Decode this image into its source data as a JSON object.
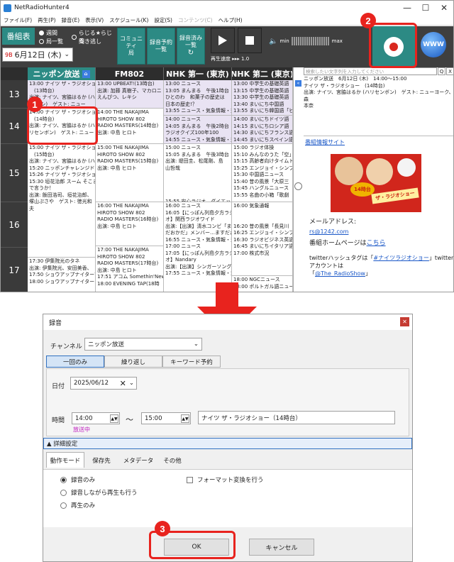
{
  "app": {
    "title": "NetRadioHunter4",
    "menu": [
      {
        "label": "ファイル(F)",
        "disabled": false
      },
      {
        "label": "再生(P)",
        "disabled": false
      },
      {
        "label": "録音(E)",
        "disabled": false
      },
      {
        "label": "表示(V)",
        "disabled": false
      },
      {
        "label": "スケジュール(K)",
        "disabled": false
      },
      {
        "label": "設定(S)",
        "disabled": false
      },
      {
        "label": "コンテンツ(C)",
        "disabled": true
      },
      {
        "label": "ヘルプ(H)",
        "disabled": false
      }
    ]
  },
  "toolbar": {
    "program_table": "番組表",
    "radio_weekly": "週間",
    "radio_station_list": "局一覧",
    "radio_rajiru": "らじる★らじる",
    "radio_rajiru2": "聞き逃し",
    "community_btn": [
      "コミュニティ",
      "局"
    ],
    "reserve_btn": [
      "録音予約",
      "一覧"
    ],
    "recorded_btn": [
      "録音済み",
      "一覧"
    ],
    "speed_label": "再生速度",
    "speed_value": "1.0",
    "vol_min": "min",
    "vol_max": "max",
    "date": "6月12日 (木)",
    "date_icon": "9B",
    "www": "WWW"
  },
  "grid": {
    "channels": [
      "ニッポン放送",
      "FM802",
      "NHK 第一 (東京)",
      "NHK 第二 (東京)"
    ],
    "hours": [
      "13",
      "14",
      "15",
      "16",
      "17"
    ],
    "programs": [
      {
        "text": "13:00 ナイツ ザ・ラジオショー\n　(13時台)\n出演: ナイツ、宮脇はるか (ハ\n/ツヨシ)　ゲスト: ニュー\nヨーク、森本奈",
        "alt": true,
        "col": 0,
        "row": 0
      },
      {
        "text": "14:00 ナイツ ザ・ラジオショー\n　(14時台)\n出演: ナイツ、宮脇はるか (ハ\nリセンボン)　ゲスト: ニュー",
        "alt": false,
        "col": 0,
        "row": 1
      },
      {
        "text": "15:00 ナイツ ザ・ラジオショー\n　(15時台)\n出演: ナイツ、宮脇はるか (ハ\n15:20 ニッポンチャレンジドアス\n15:26 ナイツ ザ・ラジオショー\n15:30 垣花治郎 スーム そこま\nで言うか！\n出演: 飯田浩司、垣花治郎、\n塚山ぷさや　ゲスト: 徳光和\n夫",
        "alt": false,
        "col": 0,
        "row": 2
      },
      {
        "text": "17:30 伊集院光のタネ\n出演: 伊集院光、安田美香、\n17:50 ショウアップナイタープレ\n18:00 ショウアップナイター　ツ",
        "alt": false,
        "col": 0,
        "row": 4
      },
      {
        "text": "13:00 UPBEAT!(13時台)\n出演: 加藤 真樹子、マカロニ\nえんぴつ、レキシ",
        "alt": true,
        "col": 1,
        "row": 0
      },
      {
        "text": "14:00 THE NAKAJIMA\nHIROTO SHOW 802\nRADIO MASTERS(14時台)\n出演: 中島 ヒロト",
        "alt": false,
        "col": 1,
        "row": 1
      },
      {
        "text": "15:00 THE NAKAJIMA\nHIROTO SHOW 802\nRADIO MASTERS(15時台)\n出演: 中島 ヒロト",
        "alt": false,
        "col": 1,
        "row": 2
      },
      {
        "text": "16:00 THE NAKAJIMA\nHIROTO SHOW 802\nRADIO MASTERS(16時台)\n出演: 中島 ヒロト",
        "alt": false,
        "col": 1,
        "row": 3
      },
      {
        "text": "17:00 THE NAKAJIMA\nHIROTO SHOW 802\nRADIO MASTERS(17時台)\n出演: 中島 ヒロト\n17:51 アコム Somethin'New\n18:00 EVENING TAP(18時",
        "alt": false,
        "col": 1,
        "row": 4
      },
      {
        "text": "13:00 ニュース\n13:05 まんまる　午後1時台\nひとのわ　和菓子の歴史は\n日本の歴史!？\n13:55 ニュース・気象情報・交",
        "alt": true,
        "col": 2,
        "row": 0
      },
      {
        "text": "14:00 ニュース\n14:05 まんまる　午後2時台\nラジオクイズ100年100\n14:55 ニュース・気象情報・交",
        "alt": true,
        "col": 2,
        "row": 1
      },
      {
        "text": "15:00 ニュース\n15:05 まんまる　午後3時台\n出演: 堤田圭、松尾剛、島\n山哲哉\n\n\n\n\n15:55 安心ラジオ　ダイエット",
        "alt": false,
        "col": 2,
        "row": 2
      },
      {
        "text": "16:00 ニュース\n16:05【にっぽん列島夕方ラジ\nオ】関西ラジオワイド\n出演:【出演】清水コンビ「ます\nだおかだ」メンバー…ますだおか\n16:55 ニュース・気象情報・交\n17:00 ニュース\n17:05【にっぽん列島夕方ラジ\nオ】Nandary\n出演:【出演】シンガーソングラ\n17:55 ニュース・気象情報・交",
        "alt": false,
        "col": 2,
        "row": 3
      },
      {
        "text": "13:00 中学生の基礎英語\n13:15 中学生の基礎英語\n13:30 中学生の基礎英語\n13:40 まいにち中国語\n13:55 まいにち韓国語「ピア",
        "alt": true,
        "col": 3,
        "row": 0
      },
      {
        "text": "14:00 まいにちドイツ語\n14:15 まいにちロシア語\n14:30 まいにちフランス語\n14:45 まいにちスペイン語",
        "alt": true,
        "col": 3,
        "row": 1
      },
      {
        "text": "15:00 ラジオ体操\n15:10 みんなのうた「空」\n15:15 高齢者向けタイムトラ\n15:25 エンジョイ・シンプル\n15:30 中国語ニュース\n15:40 昔の風景「大原三\n15:45 ハングルニュース\n15:55 名曲の小箱「歌劇",
        "alt": false,
        "col": 3,
        "row": 2
      },
      {
        "text": "16:00 気象通報\n\n\n16:20 昔の風景「長見川\n16:25 エンジョイ・シンプル\n16:30 ラジオビジネス英語\n16:45 まいにちイタリア語\n17:00 株式市況",
        "alt": false,
        "col": 3,
        "row": 3
      },
      {
        "text": "18:00 NGCニュース\n18:00 ポルトガル語ニュース",
        "alt": false,
        "col": 3,
        "row": 5
      }
    ]
  },
  "side": {
    "search_placeholder": "検索したい文字列を入力してください",
    "search_q": "Q",
    "search_x": "X",
    "info": "ニッポン放送　6月12日 (木)　14:00～15:00\nナイツ ザ・ラジオショー　(14時台)\n出演: ナイツ、宮脇はるか (ハリセンボン)　ゲスト: ニューヨーク、森\n本奈",
    "site_link": "番組情報サイト",
    "image_badge": "14時台",
    "image_title": "ザ・ラジオショー",
    "mail_label": "メールアドレス:",
    "mail_value": "rs@1242.com",
    "homepage_prefix": "番組ホームページは",
    "homepage_link": "こちら",
    "hashtag_prefix": "twitterハッシュタグは「",
    "hashtag": "#ナイツラジオショー",
    "account_mid": "」twitterアカウントは",
    "account_prefix": "「",
    "account": "@The_RadioShow",
    "account_suffix": "」"
  },
  "dialog": {
    "title": "録音",
    "channel_label": "チャンネル",
    "channel_value": "ニッポン放送",
    "tabs": [
      "一回のみ",
      "繰り返し",
      "キーワード予約"
    ],
    "date_label": "日付",
    "date_value": "2025/06/12",
    "time_label": "時間",
    "start_time": "14:00",
    "tilde": "～",
    "end_time": "15:00",
    "program_name": "ナイツ ザ・ラジオショー（14時台）",
    "on_air": "放送中",
    "detail_label": "▲ 詳細設定",
    "sub_tabs": [
      "動作モード",
      "保存先",
      "メタデータ",
      "その他"
    ],
    "mode_options": [
      "録音のみ",
      "録音しながら再生も行う",
      "再生のみ"
    ],
    "format_convert": "フォーマット変換を行う",
    "ok": "OK",
    "cancel": "キャンセル"
  },
  "annotations": [
    "1",
    "2",
    "3"
  ],
  "colors": {
    "accent": "#2c8a84",
    "highlight": "#e8231e",
    "link": "#1a57c7"
  }
}
